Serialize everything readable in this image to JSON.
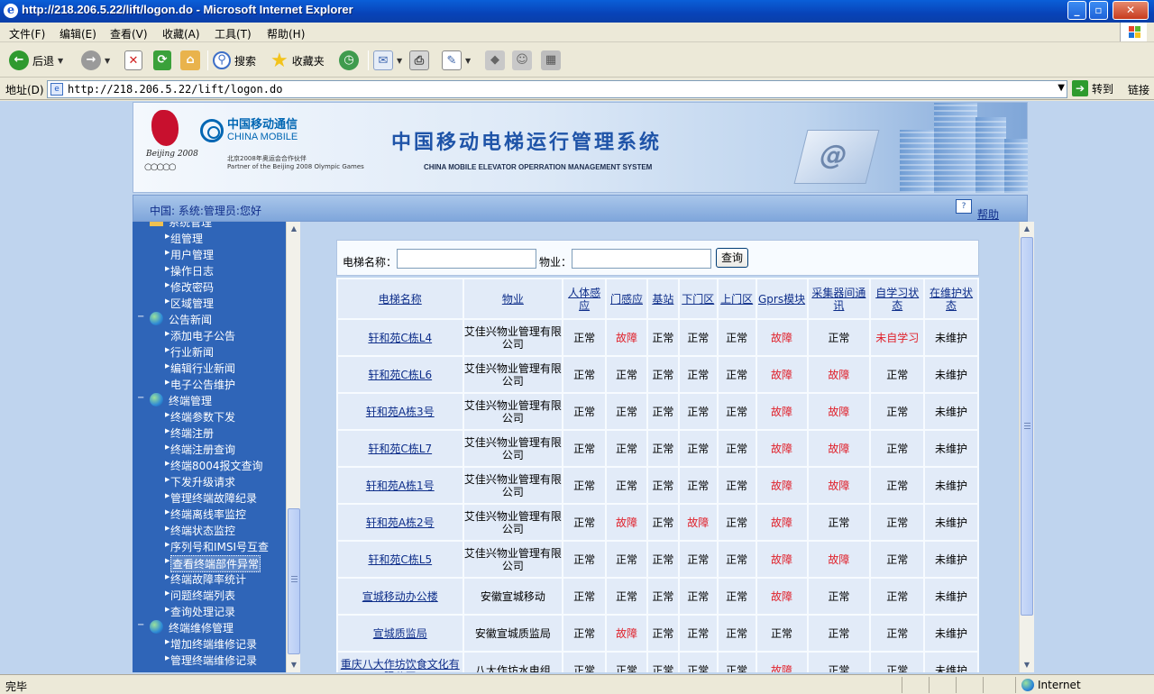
{
  "window": {
    "title": "http://218.206.5.22/lift/logon.do - Microsoft Internet Explorer"
  },
  "menu": [
    "文件(F)",
    "编辑(E)",
    "查看(V)",
    "收藏(A)",
    "工具(T)",
    "帮助(H)"
  ],
  "toolbar": {
    "back": "后退",
    "search": "搜索",
    "favorites": "收藏夹"
  },
  "address": {
    "label": "地址(D)",
    "url": "http://218.206.5.22/lift/logon.do",
    "go": "转到",
    "links": "链接"
  },
  "banner": {
    "title": "中国移动电梯运行管理系统",
    "subtitle": "CHINA MOBILE ELEVATOR OPERRATION MANAGEMENT  SYSTEM",
    "brand_cn": "中国移动通信",
    "brand_en": "CHINA MOBILE",
    "partner_cn": "北京2008年奥运会合作伙伴",
    "partner_en": "Partner of the Beijing 2008 Olympic Games",
    "olympic": "Beijing 2008"
  },
  "infobar": {
    "text": "中国:  系统:管理员:您好",
    "help": "帮助"
  },
  "sidebar": {
    "groups": [
      {
        "label": "系统管理",
        "icon": "folder-icon",
        "items": [
          "组管理",
          "用户管理",
          "操作日志",
          "修改密码",
          "区域管理"
        ]
      },
      {
        "label": "公告新闻",
        "icon": "globe-icon",
        "items": [
          "添加电子公告",
          "行业新闻",
          "编辑行业新闻",
          "电子公告维护"
        ]
      },
      {
        "label": "终端管理",
        "icon": "globe-icon",
        "items": [
          "终端参数下发",
          "终端注册",
          "终端注册查询",
          "终端8004报文查询",
          "下发升级请求",
          "管理终端故障纪录",
          "终端离线率监控",
          "终端状态监控",
          "序列号和IMSI号互查",
          "查看终端部件异常",
          "终端故障率统计",
          "问题终端列表",
          "查询处理记录"
        ]
      },
      {
        "label": "终端维修管理",
        "icon": "globe-icon",
        "items": [
          "增加终端维修记录",
          "管理终端维修记录"
        ]
      }
    ],
    "selected": "查看终端部件异常"
  },
  "search": {
    "name_label": "电梯名称：",
    "property_label": "物业：",
    "button": "查询",
    "name_value": "",
    "property_value": ""
  },
  "table": {
    "headers": [
      "电梯名称",
      "物业",
      "人体感应",
      "门感应",
      "基站",
      "下门区",
      "上门区",
      "Gprs模块",
      "采集器间通讯",
      "自学习状态",
      "在维护状态"
    ],
    "rows": [
      [
        "轩和苑C栋L4",
        "艾佳兴物业管理有限公司",
        "正常",
        "故障",
        "正常",
        "正常",
        "正常",
        "故障",
        "正常",
        "未自学习",
        "未维护"
      ],
      [
        "轩和苑C栋L6",
        "艾佳兴物业管理有限公司",
        "正常",
        "正常",
        "正常",
        "正常",
        "正常",
        "故障",
        "故障",
        "正常",
        "未维护"
      ],
      [
        "轩和苑A栋3号",
        "艾佳兴物业管理有限公司",
        "正常",
        "正常",
        "正常",
        "正常",
        "正常",
        "故障",
        "故障",
        "正常",
        "未维护"
      ],
      [
        "轩和苑C栋L7",
        "艾佳兴物业管理有限公司",
        "正常",
        "正常",
        "正常",
        "正常",
        "正常",
        "故障",
        "故障",
        "正常",
        "未维护"
      ],
      [
        "轩和苑A栋1号",
        "艾佳兴物业管理有限公司",
        "正常",
        "正常",
        "正常",
        "正常",
        "正常",
        "故障",
        "故障",
        "正常",
        "未维护"
      ],
      [
        "轩和苑A栋2号",
        "艾佳兴物业管理有限公司",
        "正常",
        "故障",
        "正常",
        "故障",
        "正常",
        "故障",
        "正常",
        "正常",
        "未维护"
      ],
      [
        "轩和苑C栋L5",
        "艾佳兴物业管理有限公司",
        "正常",
        "正常",
        "正常",
        "正常",
        "正常",
        "故障",
        "故障",
        "正常",
        "未维护"
      ],
      [
        "宣城移动办公楼",
        "安徽宣城移动",
        "正常",
        "正常",
        "正常",
        "正常",
        "正常",
        "故障",
        "正常",
        "正常",
        "未维护"
      ],
      [
        "宣城质监局",
        "安徽宣城质监局",
        "正常",
        "故障",
        "正常",
        "正常",
        "正常",
        "正常",
        "正常",
        "正常",
        "未维护"
      ],
      [
        "重庆八大作坊饮食文化有限公司",
        "八大作坊水电组",
        "正常",
        "正常",
        "正常",
        "正常",
        "正常",
        "故障",
        "正常",
        "正常",
        "未维护"
      ]
    ],
    "fault_words": [
      "故障",
      "未自学习"
    ]
  },
  "status": {
    "text": "完毕",
    "zone": "Internet"
  },
  "colors": {
    "accent": "#2F65B8",
    "fault": "#E0202A",
    "link": "#0E2E8A"
  }
}
